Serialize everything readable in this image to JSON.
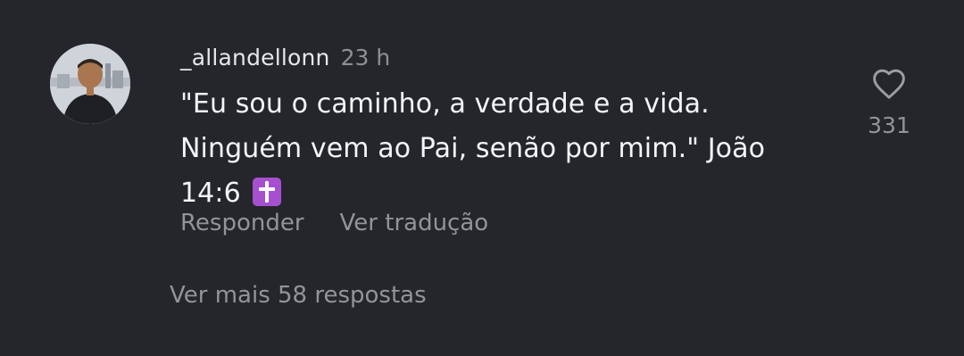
{
  "comment": {
    "username": "_allandellonn",
    "time": "23 h",
    "text": "\"Eu sou o caminho, a verdade e a vida. Ninguém vem ao Pai, senão por mim.\" João 14:6",
    "emoji": "cross-emoji",
    "actions": {
      "reply_label": "Responder",
      "translate_label": "Ver tradução"
    },
    "likes": "331",
    "more_replies_label": "Ver mais 58 respostas"
  },
  "colors": {
    "background": "#24262b",
    "primary_text": "#f4f5f7",
    "secondary_text": "#92949a",
    "emoji_purple": "#a64fd0"
  },
  "icons": {
    "avatar": "avatar",
    "like": "heart-icon"
  }
}
